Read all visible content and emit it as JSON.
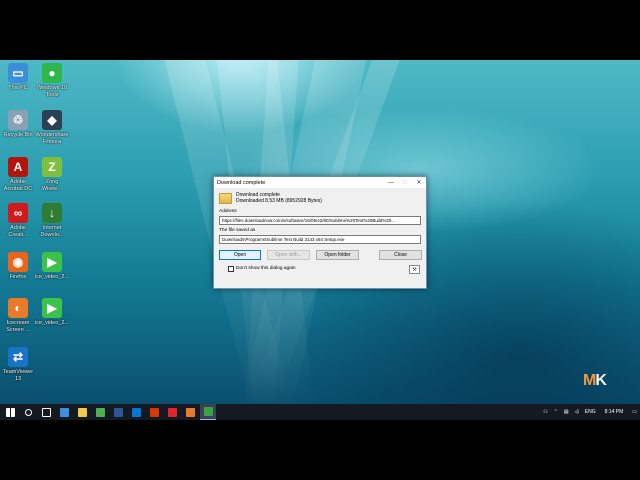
{
  "desktop": {
    "icons": [
      {
        "label": "This PC",
        "icon": "this-pc-icon",
        "color": "#3a8fd8",
        "glyph": "▭"
      },
      {
        "label": "Windows 10\nTools",
        "icon": "windows-tools-icon",
        "color": "#2fb84a",
        "glyph": "●"
      },
      {
        "label": "Recycle Bin",
        "icon": "recycle-bin-icon",
        "color": "#8aa0b4",
        "glyph": "♲"
      },
      {
        "label": "Wondershare\nFilmora",
        "icon": "filmora-icon",
        "color": "#2b3f55",
        "glyph": "◆"
      },
      {
        "label": "Adobe\nAcrobat DC",
        "icon": "acrobat-icon",
        "color": "#b3140e",
        "glyph": "A"
      },
      {
        "label": "Zong\nWirele...",
        "icon": "zong-icon",
        "color": "#7fbf3f",
        "glyph": "Z"
      },
      {
        "label": "Adobe\nCreati...",
        "icon": "creative-cloud-icon",
        "color": "#d11a1a",
        "glyph": "∞"
      },
      {
        "label": "Internet\nDownlo...",
        "icon": "idm-icon",
        "color": "#2e7d32",
        "glyph": "↓"
      },
      {
        "label": "Firefox",
        "icon": "firefox-icon",
        "color": "#e8661c",
        "glyph": "◉"
      },
      {
        "label": "ice_video_2...",
        "icon": "webm-video-icon",
        "color": "#3cc24a",
        "glyph": "▶"
      },
      {
        "label": "Icecream\nScreen ...",
        "icon": "icecream-icon",
        "color": "#e87a2a",
        "glyph": "◐"
      },
      {
        "label": "ice_video_2...",
        "icon": "webm-video-icon-2",
        "color": "#3cc24a",
        "glyph": "▶"
      },
      {
        "label": "TeamViewer\n13",
        "icon": "teamviewer-icon",
        "color": "#1a72c9",
        "glyph": "⇄"
      }
    ]
  },
  "dialog": {
    "title": "Download complete",
    "minimize": "—",
    "maximize": "□",
    "close": "✕",
    "status": "Download complete",
    "size_text": "Downloaded 8.53  MB (8952928 Bytes)",
    "address_label": "Address",
    "address_value": "https://files.downloadnow.com/s/software/16/09/42/80/Sublime%20Text%20Build%20...",
    "saved_label": "The file saved as",
    "saved_value": "Downloads\\Programs\\Sublime Text Build 3143 x64 Setup.exe",
    "buttons": {
      "open": "Open",
      "open_with": "Open with...",
      "open_folder": "Open folder",
      "close": "Close"
    },
    "checkbox_label": "Don't show this dialog again"
  },
  "taskbar": {
    "items": [
      {
        "icon": "windows-start-icon",
        "color": "#ffffff"
      },
      {
        "icon": "search-icon",
        "color": "#ffffff"
      },
      {
        "icon": "task-view-icon",
        "color": "#ffffff"
      },
      {
        "icon": "edge-icon",
        "color": "#3b8fe0"
      },
      {
        "icon": "file-explorer-icon",
        "color": "#f2c94c"
      },
      {
        "icon": "chrome-icon",
        "color": "#4caf50"
      },
      {
        "icon": "word-icon",
        "color": "#2b579a"
      },
      {
        "icon": "ms-store-icon",
        "color": "#0078d7"
      },
      {
        "icon": "office-icon",
        "color": "#d83b01"
      },
      {
        "icon": "opera-icon",
        "color": "#e0232d"
      },
      {
        "icon": "icecream-taskbar-icon",
        "color": "#e87a2a"
      },
      {
        "icon": "idm-taskbar-icon",
        "color": "#3ba24a"
      }
    ],
    "tray": {
      "language": "ENG",
      "time": "8:14 PM"
    }
  },
  "watermark": {
    "text": "MK"
  }
}
